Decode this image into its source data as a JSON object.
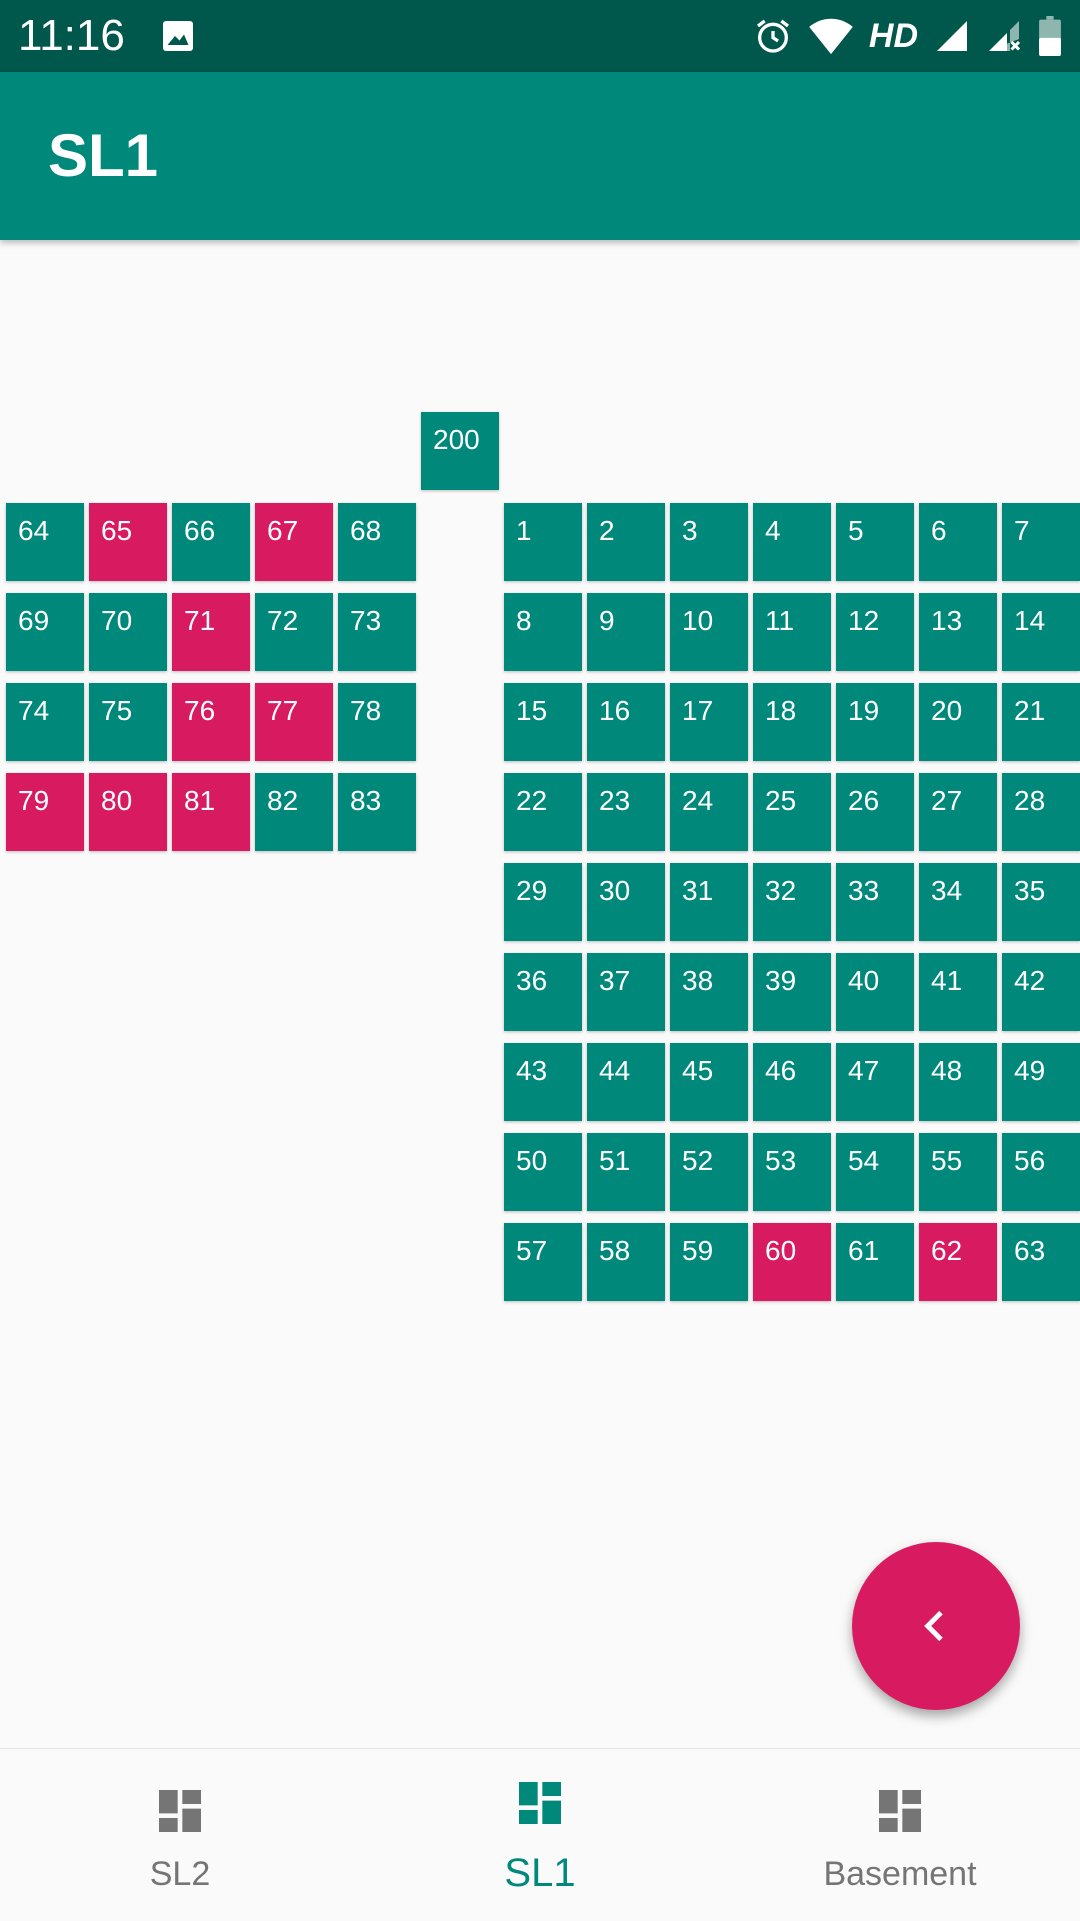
{
  "status_bar": {
    "time": "11:16",
    "network_label": "HD",
    "icons": [
      "photo-icon",
      "alarm-icon",
      "wifi-icon",
      "signal-icon",
      "signal-no-sim-icon",
      "battery-icon"
    ]
  },
  "app_bar": {
    "title": "SL1"
  },
  "colors": {
    "available": "#00897b",
    "occupied": "#d81b60",
    "primary_dark": "#00574b",
    "inactive_nav": "#757575"
  },
  "slots": [
    {
      "label": "200",
      "status": "available"
    },
    {
      "label": "64",
      "status": "available"
    },
    {
      "label": "65",
      "status": "occupied"
    },
    {
      "label": "66",
      "status": "available"
    },
    {
      "label": "67",
      "status": "occupied"
    },
    {
      "label": "68",
      "status": "available"
    },
    {
      "label": "69",
      "status": "available"
    },
    {
      "label": "70",
      "status": "available"
    },
    {
      "label": "71",
      "status": "occupied"
    },
    {
      "label": "72",
      "status": "available"
    },
    {
      "label": "73",
      "status": "available"
    },
    {
      "label": "74",
      "status": "available"
    },
    {
      "label": "75",
      "status": "available"
    },
    {
      "label": "76",
      "status": "occupied"
    },
    {
      "label": "77",
      "status": "occupied"
    },
    {
      "label": "78",
      "status": "available"
    },
    {
      "label": "79",
      "status": "occupied"
    },
    {
      "label": "80",
      "status": "occupied"
    },
    {
      "label": "81",
      "status": "occupied"
    },
    {
      "label": "82",
      "status": "available"
    },
    {
      "label": "83",
      "status": "available"
    },
    {
      "label": "1",
      "status": "available"
    },
    {
      "label": "2",
      "status": "available"
    },
    {
      "label": "3",
      "status": "available"
    },
    {
      "label": "4",
      "status": "available"
    },
    {
      "label": "5",
      "status": "available"
    },
    {
      "label": "6",
      "status": "available"
    },
    {
      "label": "7",
      "status": "available"
    },
    {
      "label": "8",
      "status": "available"
    },
    {
      "label": "9",
      "status": "available"
    },
    {
      "label": "10",
      "status": "available"
    },
    {
      "label": "11",
      "status": "available"
    },
    {
      "label": "12",
      "status": "available"
    },
    {
      "label": "13",
      "status": "available"
    },
    {
      "label": "14",
      "status": "available"
    },
    {
      "label": "15",
      "status": "available"
    },
    {
      "label": "16",
      "status": "available"
    },
    {
      "label": "17",
      "status": "available"
    },
    {
      "label": "18",
      "status": "available"
    },
    {
      "label": "19",
      "status": "available"
    },
    {
      "label": "20",
      "status": "available"
    },
    {
      "label": "21",
      "status": "available"
    },
    {
      "label": "22",
      "status": "available"
    },
    {
      "label": "23",
      "status": "available"
    },
    {
      "label": "24",
      "status": "available"
    },
    {
      "label": "25",
      "status": "available"
    },
    {
      "label": "26",
      "status": "available"
    },
    {
      "label": "27",
      "status": "available"
    },
    {
      "label": "28",
      "status": "available"
    },
    {
      "label": "29",
      "status": "available"
    },
    {
      "label": "30",
      "status": "available"
    },
    {
      "label": "31",
      "status": "available"
    },
    {
      "label": "32",
      "status": "available"
    },
    {
      "label": "33",
      "status": "available"
    },
    {
      "label": "34",
      "status": "available"
    },
    {
      "label": "35",
      "status": "available"
    },
    {
      "label": "36",
      "status": "available"
    },
    {
      "label": "37",
      "status": "available"
    },
    {
      "label": "38",
      "status": "available"
    },
    {
      "label": "39",
      "status": "available"
    },
    {
      "label": "40",
      "status": "available"
    },
    {
      "label": "41",
      "status": "available"
    },
    {
      "label": "42",
      "status": "available"
    },
    {
      "label": "43",
      "status": "available"
    },
    {
      "label": "44",
      "status": "available"
    },
    {
      "label": "45",
      "status": "available"
    },
    {
      "label": "46",
      "status": "available"
    },
    {
      "label": "47",
      "status": "available"
    },
    {
      "label": "48",
      "status": "available"
    },
    {
      "label": "49",
      "status": "available"
    },
    {
      "label": "50",
      "status": "available"
    },
    {
      "label": "51",
      "status": "available"
    },
    {
      "label": "52",
      "status": "available"
    },
    {
      "label": "53",
      "status": "available"
    },
    {
      "label": "54",
      "status": "available"
    },
    {
      "label": "55",
      "status": "available"
    },
    {
      "label": "56",
      "status": "available"
    },
    {
      "label": "57",
      "status": "available"
    },
    {
      "label": "58",
      "status": "available"
    },
    {
      "label": "59",
      "status": "available"
    },
    {
      "label": "60",
      "status": "occupied"
    },
    {
      "label": "61",
      "status": "available"
    },
    {
      "label": "62",
      "status": "occupied"
    },
    {
      "label": "63",
      "status": "available"
    }
  ],
  "fab": {
    "icon": "chevron-left-icon"
  },
  "bottom_nav": {
    "items": [
      {
        "label": "SL2",
        "icon": "dashboard-icon",
        "active": false
      },
      {
        "label": "SL1",
        "icon": "dashboard-icon",
        "active": true
      },
      {
        "label": "Basement",
        "icon": "dashboard-icon",
        "active": false
      }
    ]
  }
}
